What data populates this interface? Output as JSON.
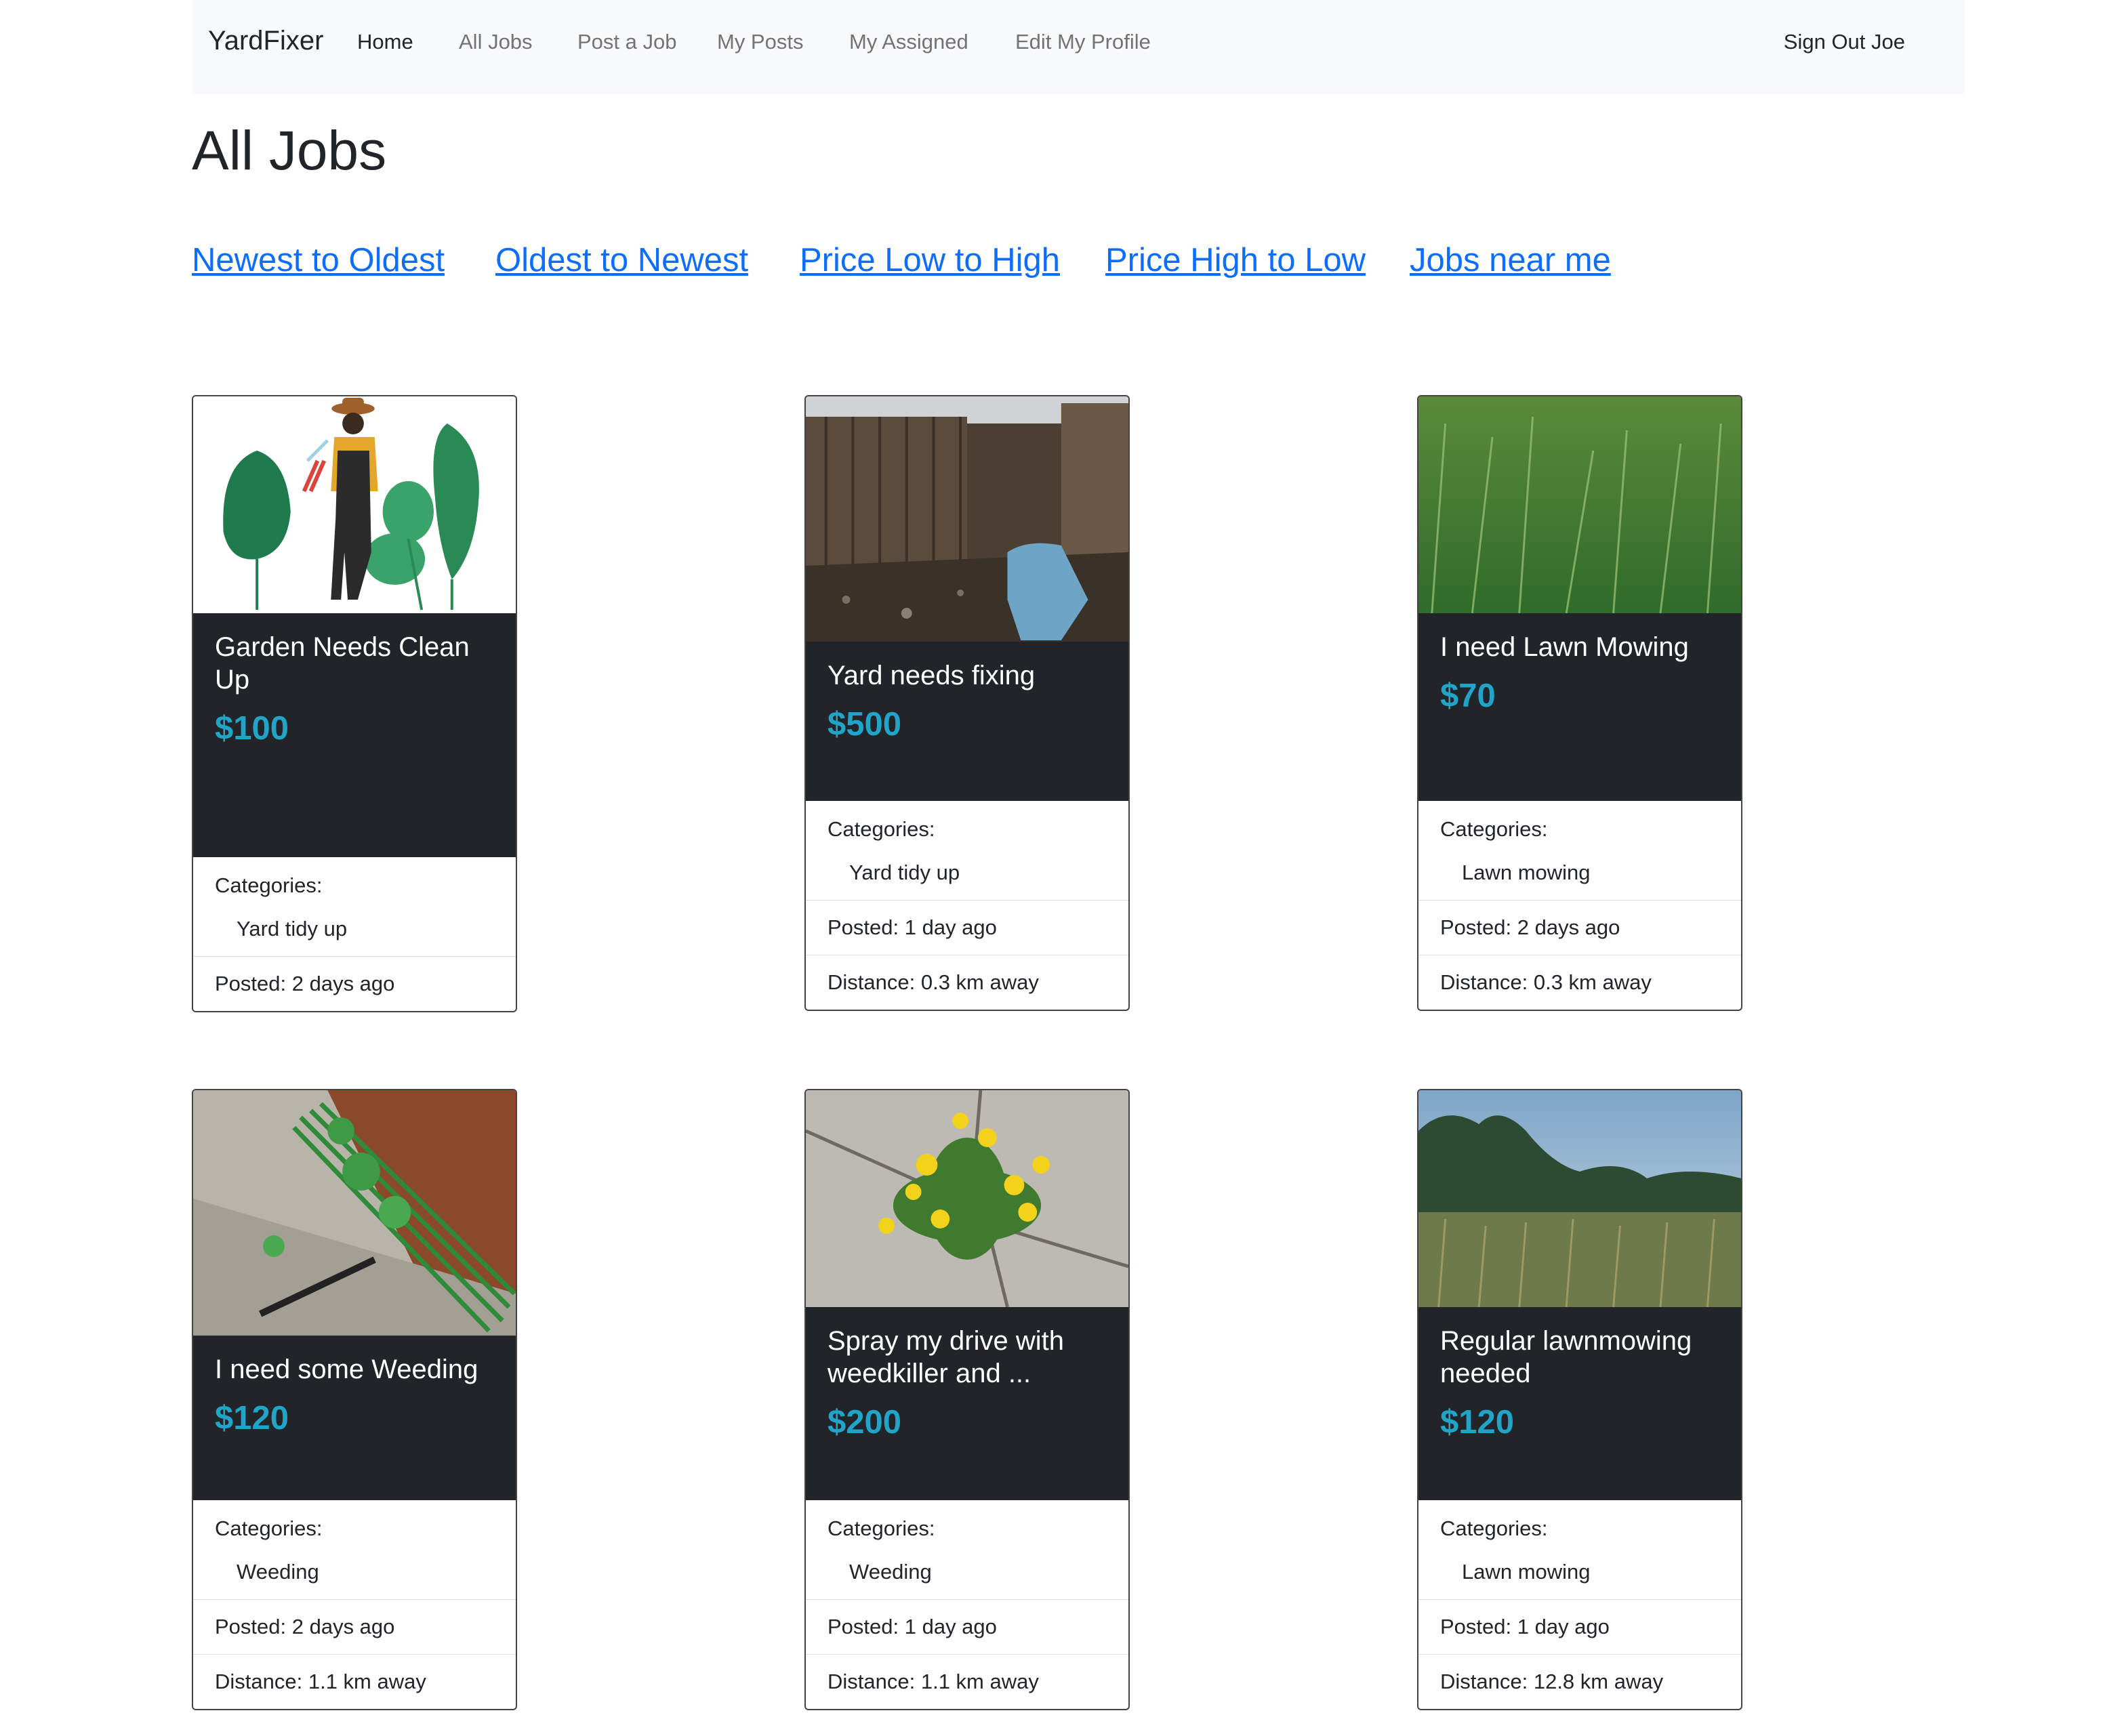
{
  "nav": {
    "brand": "YardFixer",
    "links": [
      "Home",
      "All Jobs",
      "Post a Job",
      "My Posts",
      "My Assigned",
      "Edit My Profile"
    ],
    "signout": "Sign Out Joe"
  },
  "page_title": "All Jobs",
  "sort_links": [
    "Newest to Oldest",
    "Oldest to Newest",
    "Price Low to High",
    "Price High to Low",
    "Jobs near me"
  ],
  "jobs": [
    {
      "title": "Garden Needs Clean Up",
      "price": "$100",
      "categories_label": "Categories:",
      "category": "Yard tidy up",
      "posted": "Posted: 2 days ago",
      "distance": "",
      "image": "gardener-illustration"
    },
    {
      "title": "Yard needs fixing",
      "price": "$500",
      "categories_label": "Categories:",
      "category": "Yard tidy up",
      "posted": "Posted: 1 day ago",
      "distance": "Distance: 0.3 km away",
      "image": "fence-yard-photo"
    },
    {
      "title": "I need Lawn Mowing",
      "price": "$70",
      "categories_label": "Categories:",
      "category": "Lawn mowing",
      "posted": "Posted: 2 days ago",
      "distance": "Distance: 0.3 km away",
      "image": "long-grass-photo"
    },
    {
      "title": "I need some Weeding",
      "price": "$120",
      "categories_label": "Categories:",
      "category": "Weeding",
      "posted": "Posted: 2 days ago",
      "distance": "Distance: 1.1 km away",
      "image": "weeds-path-photo"
    },
    {
      "title": "Spray my drive with weedkiller and ...",
      "price": "$200",
      "categories_label": "Categories:",
      "category": "Weeding",
      "posted": "Posted: 1 day ago",
      "distance": "Distance: 1.1 km away",
      "image": "dandelion-photo"
    },
    {
      "title": "Regular lawnmowing needed",
      "price": "$120",
      "categories_label": "Categories:",
      "category": "Lawn mowing",
      "posted": "Posted: 1 day ago",
      "distance": "Distance: 12.8 km away",
      "image": "meadow-photo"
    }
  ]
}
